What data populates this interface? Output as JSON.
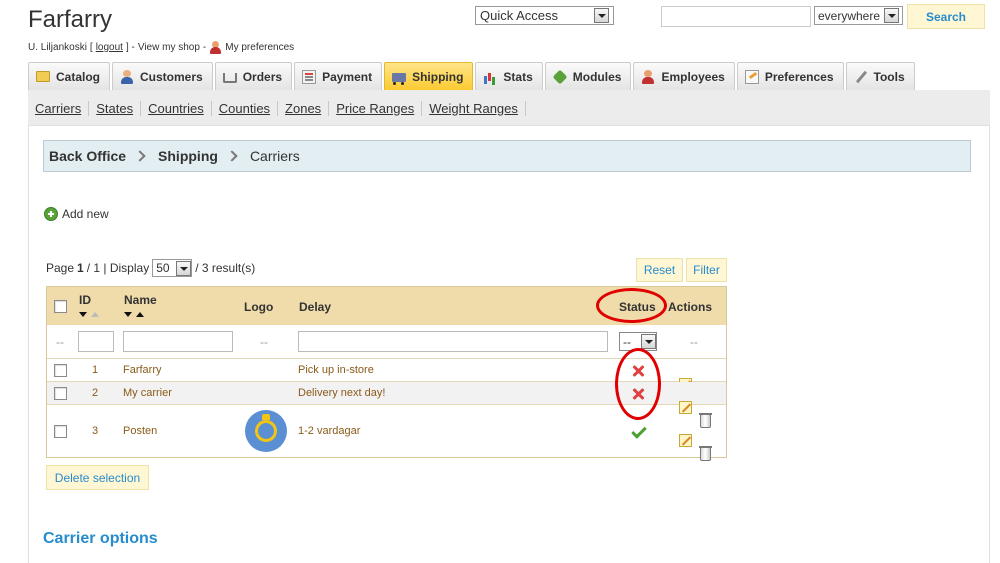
{
  "shop": {
    "name": "Farfarry",
    "user": "U. Liljankoski",
    "bracket_open": "[",
    "logout": "logout",
    "bracket_close": "] -",
    "view_shop": "View my shop",
    "dash": "-",
    "preferences": "My preferences"
  },
  "header": {
    "quick_access": "Quick Access",
    "search_value": "",
    "search_scope": "everywhere",
    "search_button": "Search"
  },
  "tabs": [
    {
      "label": "Catalog",
      "icon": "folder-icon"
    },
    {
      "label": "Customers",
      "icon": "customers-icon"
    },
    {
      "label": "Orders",
      "icon": "cart-icon"
    },
    {
      "label": "Payment",
      "icon": "payment-icon"
    },
    {
      "label": "Shipping",
      "icon": "truck-icon",
      "active": true
    },
    {
      "label": "Stats",
      "icon": "stats-icon"
    },
    {
      "label": "Modules",
      "icon": "puzzle-icon"
    },
    {
      "label": "Employees",
      "icon": "employees-icon"
    },
    {
      "label": "Preferences",
      "icon": "preferences-icon"
    },
    {
      "label": "Tools",
      "icon": "wrench-icon"
    }
  ],
  "subnav": [
    "Carriers",
    "States",
    "Countries",
    "Counties",
    "Zones",
    "Price Ranges",
    "Weight Ranges"
  ],
  "breadcrumb": [
    "Back Office",
    "Shipping",
    "Carriers"
  ],
  "actions": {
    "add_new": "Add new",
    "reset": "Reset",
    "filter": "Filter",
    "delete_selection": "Delete selection"
  },
  "pagination": {
    "page_label": "Page",
    "current": "1",
    "of": "/ 1 | Display",
    "per_page": "50",
    "results": "/ 3 result(s)"
  },
  "table": {
    "columns": {
      "id": "ID",
      "name": "Name",
      "logo": "Logo",
      "delay": "Delay",
      "status": "Status",
      "actions": "Actions"
    },
    "filter_placeholder_dash": "--",
    "status_filter_value": "--",
    "rows": [
      {
        "id": "1",
        "name": "Farfarry",
        "delay": "Pick up in-store",
        "status": "disabled",
        "has_logo": false
      },
      {
        "id": "2",
        "name": "My carrier",
        "delay": "Delivery next day!",
        "status": "disabled",
        "has_logo": false
      },
      {
        "id": "3",
        "name": "Posten",
        "delay": "1-2 vardagar",
        "status": "enabled",
        "has_logo": true
      }
    ]
  },
  "sections": {
    "carrier_options": "Carrier options"
  },
  "colors": {
    "accent": "#268ccd",
    "active_tab": "#fccb31",
    "table_header": "#f0dbaa",
    "annotation": "#e00000",
    "status_disabled": "#e04040",
    "status_enabled": "#4aa030"
  }
}
